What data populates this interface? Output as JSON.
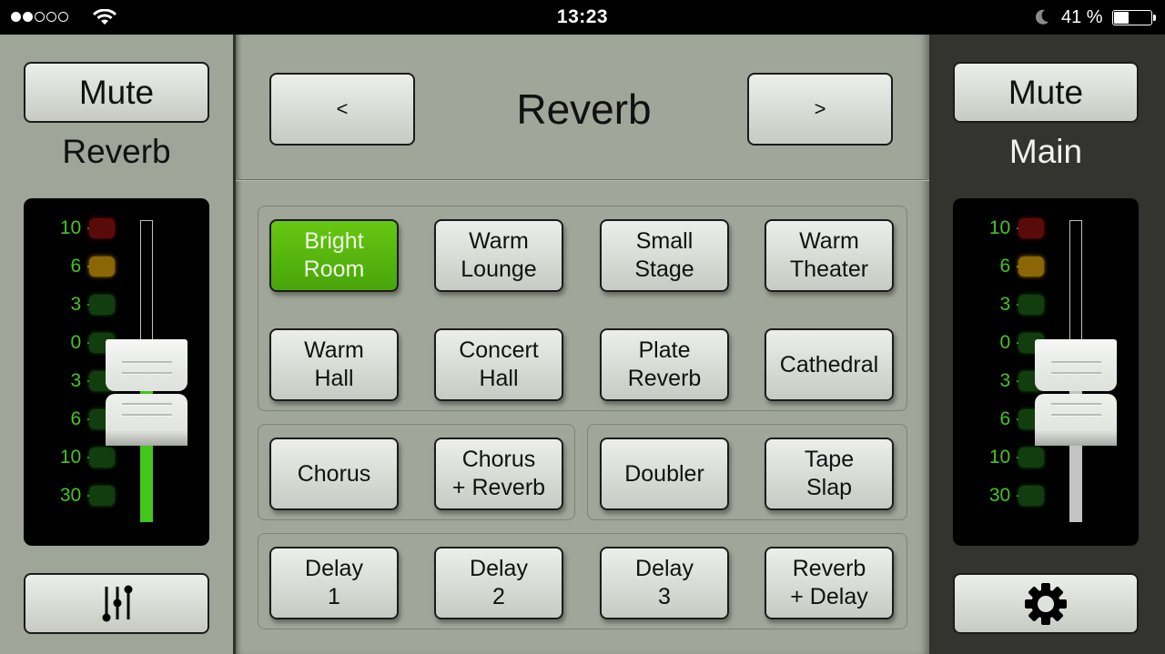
{
  "status_bar": {
    "signal_dots_filled": 2,
    "signal_dots_total": 5,
    "wifi_icon": "wifi-icon",
    "time": "13:23",
    "do_not_disturb_icon": "moon-icon",
    "battery_percent_text": "41 %",
    "battery_level": 0.41
  },
  "left_strip": {
    "mute_label": "Mute",
    "channel_name": "Reverb",
    "meter_scale": [
      "10",
      "6",
      "3",
      "0",
      "3",
      "6",
      "10",
      "30"
    ],
    "led_colors": [
      "red",
      "amber",
      "green",
      "green",
      "green",
      "green",
      "green",
      "green"
    ],
    "fader_level": 0.5,
    "meter_fill_color": "#43c61b",
    "bottom_button_icon": "mixer-sliders-icon"
  },
  "center": {
    "title": "Reverb",
    "prev_label": "<",
    "next_label": ">",
    "selected_preset": "Bright Room",
    "accent_color": "#5bbf0e",
    "groups": [
      {
        "name": "reverbs",
        "presets": [
          [
            "Bright",
            "Room"
          ],
          [
            "Warm",
            "Lounge"
          ],
          [
            "Small",
            "Stage"
          ],
          [
            "Warm",
            "Theater"
          ],
          [
            "Warm",
            "Hall"
          ],
          [
            "Concert",
            "Hall"
          ],
          [
            "Plate",
            "Reverb"
          ],
          [
            "Cathedral"
          ]
        ]
      },
      {
        "name": "chorus",
        "presets": [
          [
            "Chorus"
          ],
          [
            "Chorus",
            "+ Reverb"
          ]
        ]
      },
      {
        "name": "doubler",
        "presets": [
          [
            "Doubler"
          ],
          [
            "Tape",
            "Slap"
          ]
        ]
      },
      {
        "name": "delays",
        "presets": [
          [
            "Delay",
            "1"
          ],
          [
            "Delay",
            "2"
          ],
          [
            "Delay",
            "3"
          ],
          [
            "Reverb",
            "+ Delay"
          ]
        ]
      }
    ]
  },
  "right_strip": {
    "mute_label": "Mute",
    "channel_name": "Main",
    "meter_scale": [
      "10",
      "6",
      "3",
      "0",
      "3",
      "6",
      "10",
      "30"
    ],
    "led_colors": [
      "red",
      "amber",
      "green",
      "green",
      "green",
      "green",
      "green",
      "green"
    ],
    "fader_level": 0.5,
    "meter_fill_color": "#c3c3c3",
    "bottom_button_icon": "gear-icon"
  }
}
